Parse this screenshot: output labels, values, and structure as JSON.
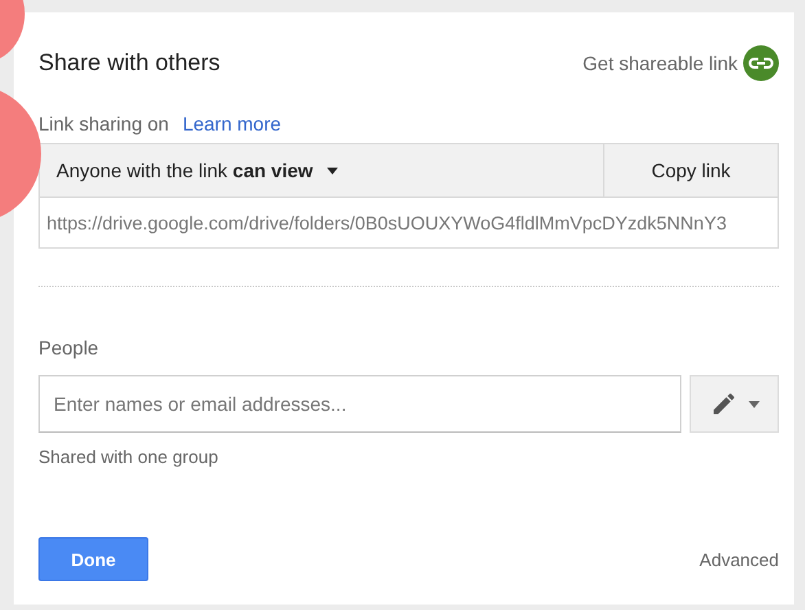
{
  "dialog": {
    "title": "Share with others",
    "shareable_link": "Get shareable link"
  },
  "link_sharing": {
    "status": "Link sharing on",
    "learn_more": "Learn more",
    "access": "Anyone with the link **can view**",
    "copy_button": "Copy link",
    "url": "https://drive.google.com/drive/folders/0B0sUOUXYWoG4fldlMmVpcDYzdk5NNnY3"
  },
  "people": {
    "label": "People",
    "placeholder": "Enter names or email addresses...",
    "note": "Shared with one group"
  },
  "footer": {
    "done": "Done",
    "advanced": "Advanced"
  }
}
